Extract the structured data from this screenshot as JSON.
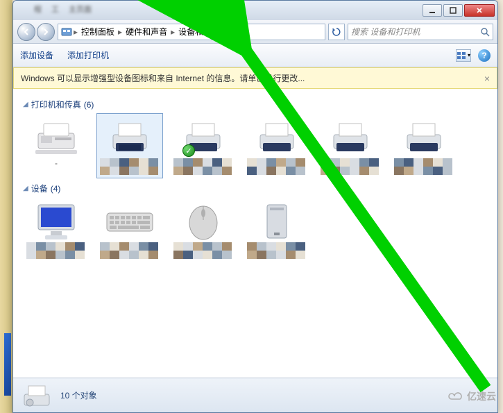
{
  "titlebar": {
    "min": "",
    "max": "",
    "close": ""
  },
  "breadcrumb": {
    "root_icon": "control-panel",
    "segments": [
      "控制面板",
      "硬件和声音",
      "设备和打印机"
    ]
  },
  "search": {
    "placeholder": "搜索 设备和打印机"
  },
  "toolbar": {
    "add_device": "添加设备",
    "add_printer": "添加打印机"
  },
  "infobar": {
    "text": "Windows 可以显示增强型设备图标和来自 Internet 的信息。请单击进行更改...",
    "close": "×"
  },
  "groups": {
    "printers": {
      "label": "打印机和传真",
      "count": "(6)"
    },
    "devices": {
      "label": "设备",
      "count": "(4)"
    }
  },
  "statusbar": {
    "text": "10 个对象"
  },
  "watermark": "亿速云",
  "pixel_palette": [
    "c1",
    "c2",
    "c3",
    "c4",
    "c5",
    "c6",
    "c7",
    "c8"
  ]
}
